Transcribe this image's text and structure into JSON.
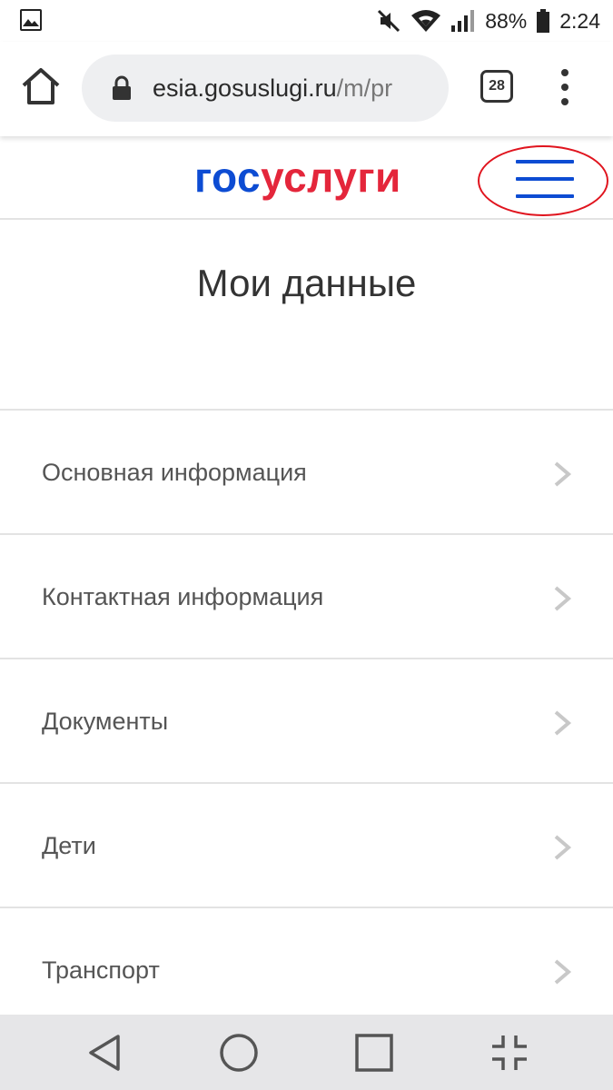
{
  "status_bar": {
    "battery": "88%",
    "time": "2:24",
    "icons": [
      "image-notification-icon",
      "mute-icon",
      "wifi-icon",
      "signal-icon",
      "battery-icon"
    ]
  },
  "browser": {
    "url_host": "esia.gosuslugi.ru",
    "url_path": "/m/pr",
    "tab_count": "28",
    "icons": [
      "home-icon",
      "lock-icon",
      "overflow-menu-icon"
    ]
  },
  "site": {
    "logo_part1": "гос",
    "logo_part2": "услуги",
    "logo_colors": {
      "gos": "#0d4cd3",
      "uslugi": "#e4263b"
    },
    "menu_icon": "hamburger-icon",
    "highlight_color": "#e0141e"
  },
  "page": {
    "title": "Мои данные"
  },
  "menu": {
    "items": [
      {
        "label": "Основная информация"
      },
      {
        "label": "Контактная информация"
      },
      {
        "label": "Документы"
      },
      {
        "label": "Дети"
      },
      {
        "label": "Транспорт"
      }
    ]
  },
  "nav_bar": {
    "icons": [
      "back-icon",
      "home-circle-icon",
      "recents-icon",
      "shrink-icon"
    ]
  }
}
